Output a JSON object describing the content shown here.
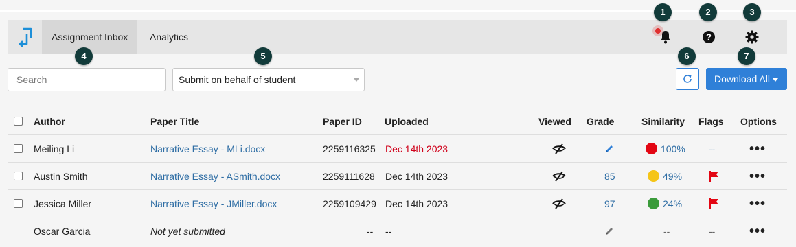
{
  "navbar": {
    "tabs": [
      {
        "label": "Assignment Inbox",
        "active": true
      },
      {
        "label": "Analytics",
        "active": false
      }
    ],
    "icons": [
      "bell-icon",
      "help-icon",
      "gear-icon"
    ]
  },
  "callouts": [
    "1",
    "2",
    "3",
    "4",
    "5",
    "6",
    "7"
  ],
  "toolbar": {
    "search_placeholder": "Search",
    "submit_select": "Submit on behalf of student",
    "download_label": "Download All"
  },
  "table": {
    "headers": {
      "author": "Author",
      "title": "Paper Title",
      "id": "Paper ID",
      "uploaded": "Uploaded",
      "viewed": "Viewed",
      "grade": "Grade",
      "similarity": "Similarity",
      "flags": "Flags",
      "options": "Options"
    },
    "rows": [
      {
        "author": "Meiling Li",
        "title": "Narrative Essay - MLi.docx",
        "id": "2259116325",
        "uploaded": "Dec 14th 2023",
        "late": true,
        "grade": "",
        "similarity": "100%",
        "similarity_color": "#e30613",
        "flags": "--"
      },
      {
        "author": "Austin Smith",
        "title": "Narrative Essay - ASmith.docx",
        "id": "2259111628",
        "uploaded": "Dec 14th 2023",
        "late": false,
        "grade": "85",
        "similarity": "49%",
        "similarity_color": "#f5c518",
        "flags": "flag"
      },
      {
        "author": "Jessica Miller",
        "title": "Narrative Essay - JMiller.docx",
        "id": "2259109429",
        "uploaded": "Dec 14th 2023",
        "late": false,
        "grade": "97",
        "similarity": "24%",
        "similarity_color": "#3a9b3a",
        "flags": "flag"
      },
      {
        "author": "Oscar Garcia",
        "title": "Not yet submitted",
        "id": "--",
        "uploaded": "--",
        "late": false,
        "grade": "",
        "similarity": "--",
        "flags": "--"
      }
    ]
  },
  "colors": {
    "accent": "#2f80d8",
    "link": "#2e6da4",
    "late": "#d0021b",
    "flag": "#e30613",
    "badge": "#123b3a"
  }
}
